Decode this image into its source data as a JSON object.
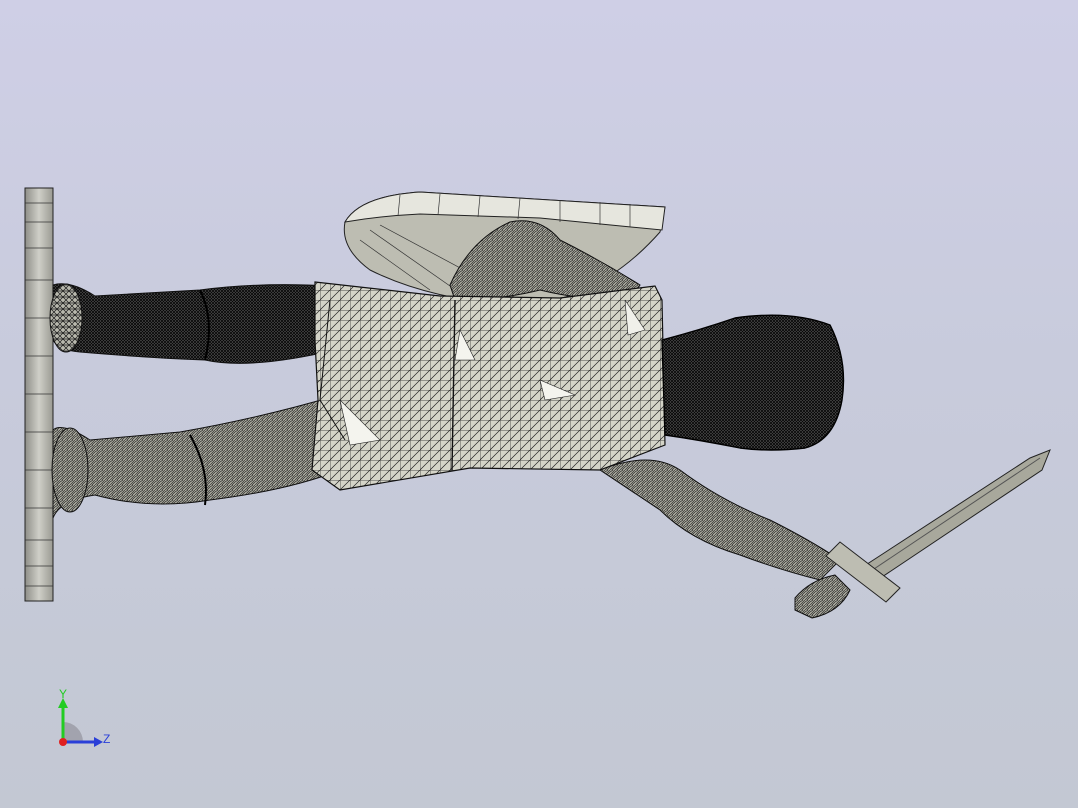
{
  "viewport": {
    "background_top": "#cfcfe6",
    "background_bottom": "#c3c8d3",
    "model_fill": "#c9c9be",
    "model_edges": "#1a1a1a",
    "model_highlight": "#f2f2ec"
  },
  "triad": {
    "y_label": "Y",
    "z_label": "Z",
    "y_color": "#22cc22",
    "z_color": "#2a3fd8",
    "x_color": "#e02020"
  }
}
